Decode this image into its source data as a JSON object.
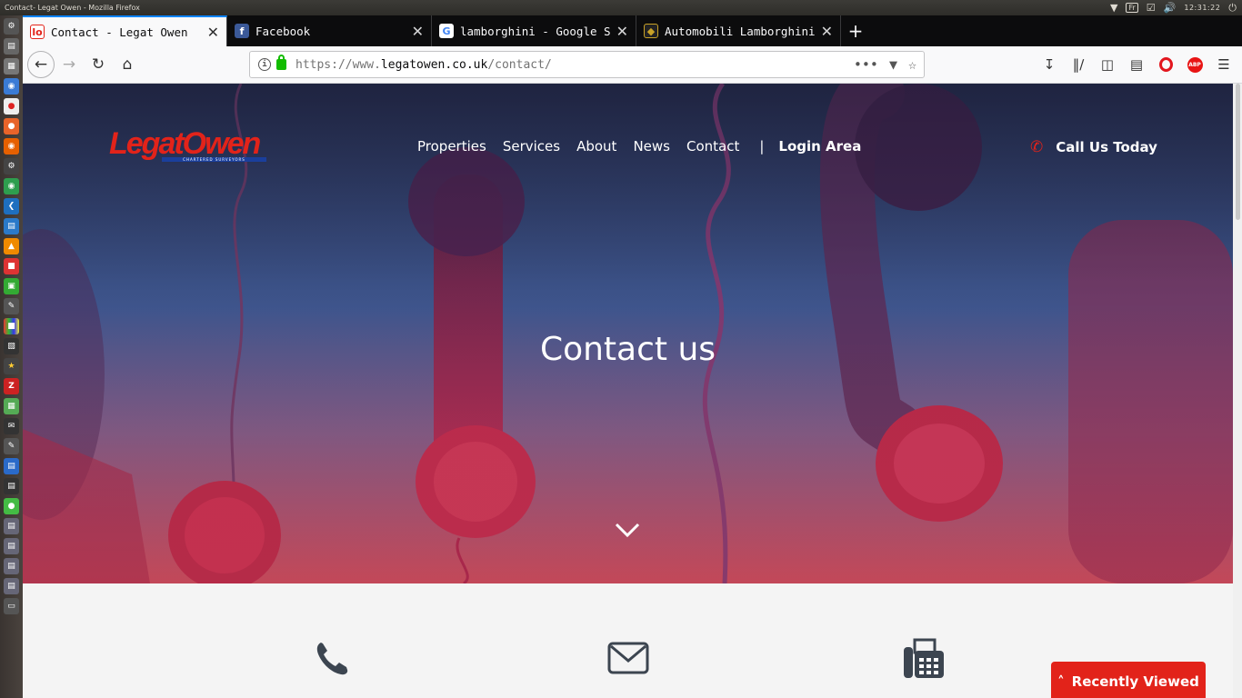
{
  "os": {
    "window_title": "Contact- Legat Owen - Mozilla Firefox",
    "keyboard_layout": "Fr",
    "clock": "12:31:22"
  },
  "browser": {
    "tabs": [
      {
        "title": "Contact - Legat Owen",
        "favicon": "lo",
        "active": true
      },
      {
        "title": "Facebook",
        "favicon": "f",
        "active": false
      },
      {
        "title": "lamborghini - Google Sea",
        "favicon": "g",
        "active": false
      },
      {
        "title": "Automobili Lamborghini",
        "favicon": "lambo",
        "active": false
      }
    ],
    "url_prefix": "https://www.",
    "url_domain": "legatowen.co.uk",
    "url_path": "/contact/"
  },
  "site": {
    "logo_text": "LegatOwen",
    "logo_tagline": "CHARTERED SURVEYORS",
    "nav": [
      "Properties",
      "Services",
      "About",
      "News",
      "Contact"
    ],
    "nav_divider": "|",
    "login": "Login Area",
    "call_us": "Call Us Today",
    "hero_title": "Contact us",
    "recently_viewed": "Recently Viewed"
  },
  "colors": {
    "brand_red": "#e2231a",
    "brand_blue": "#1a3f9c",
    "icon_gray": "#3c4550"
  }
}
